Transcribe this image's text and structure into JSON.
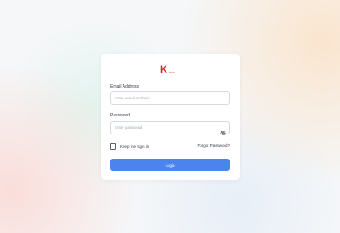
{
  "brand": {
    "mark": "K",
    "text": "kalium",
    "color": "#d9232d"
  },
  "form": {
    "email": {
      "label": "Email Address",
      "placeholder": "Enter email address",
      "value": ""
    },
    "password": {
      "label": "Password",
      "placeholder": "Enter password",
      "value": "",
      "toggle_icon": "eye-slash-icon"
    },
    "remember": {
      "label": "Keep me sign in",
      "checked": false
    },
    "forgot_label": "Forgot Password?",
    "submit_label": "Login"
  },
  "colors": {
    "accent": "#4a84ec",
    "text": "#333a44",
    "border": "#d6dbe1"
  }
}
